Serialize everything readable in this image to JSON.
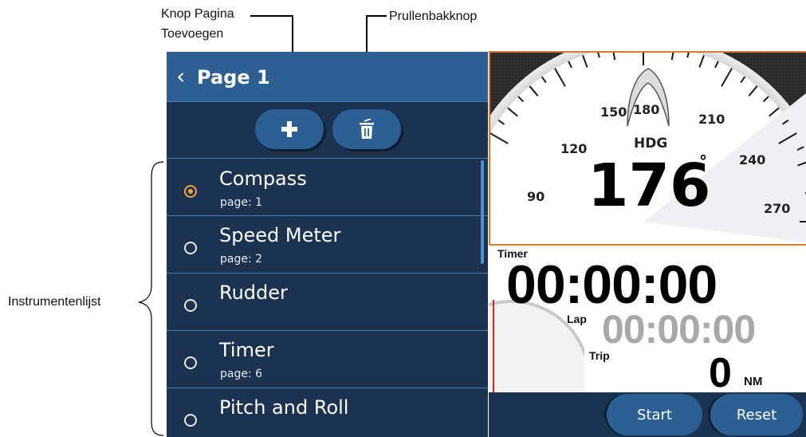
{
  "callouts": {
    "add_page_line1": "Knop Pagina",
    "add_page_line2": "Toevoegen",
    "trash": "Prullenbakknop",
    "instrument_list": "Instrumentenlijst"
  },
  "header": {
    "back_icon": "chevron-left-icon",
    "title": "Page 1"
  },
  "toolbar": {
    "add_icon": "plus-icon",
    "trash_icon": "trash-icon"
  },
  "instruments": [
    {
      "name": "Compass",
      "page": "page: 1",
      "selected": true
    },
    {
      "name": "Speed Meter",
      "page": "page: 2",
      "selected": false
    },
    {
      "name": "Rudder",
      "page": "",
      "selected": false
    },
    {
      "name": "Timer",
      "page": "page: 6",
      "selected": false
    },
    {
      "name": "Pitch and Roll",
      "page": "",
      "selected": false
    }
  ],
  "compass": {
    "label": "HDG",
    "heading": "176",
    "degree_symbol": "°",
    "scale_labels": [
      "90",
      "120",
      "150",
      "180",
      "210",
      "240",
      "270"
    ]
  },
  "timer": {
    "title": "Timer",
    "main": "00:00:00",
    "lap_label": "Lap",
    "lap": "00:00:00",
    "trip_label": "Trip",
    "trip_value": "0",
    "trip_unit": "NM"
  },
  "buttons": {
    "start": "Start",
    "reset": "Reset"
  },
  "colors": {
    "header": "#2d5f92",
    "panel": "#1b3350",
    "accent": "#f3a33b",
    "border": "#e07a2d"
  }
}
